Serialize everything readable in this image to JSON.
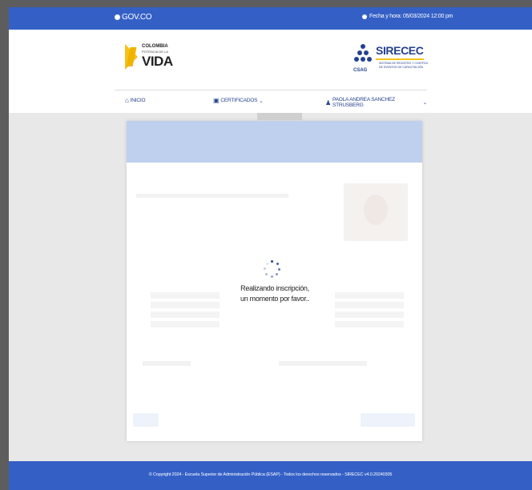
{
  "govbar": {
    "logo_text": "GOV.CO",
    "datetime": "Fecha y hora: 05/03/2024 12:00 pm"
  },
  "brand": {
    "colombia_line1": "COLOMBIA",
    "colombia_line2": "POTENCIA DE LA",
    "colombia_line3": "VIDA",
    "sirecec_name": "SIRECEC",
    "sirecec_sub": "SISTEMA DE REGISTRO Y CONTROL DE EVENTOS DE CAPACITACIÓN",
    "csag": "CSAG"
  },
  "nav": {
    "home": "INICIO",
    "certificates": "CERTIFICADOS",
    "user": "PAOLA ANDREA SANCHEZ STRUSBERG"
  },
  "loading": {
    "line1": "Realizando inscripción,",
    "line2": "un momento por favor.."
  },
  "footer": {
    "copyright": "© Copyright 2024 - Escuela Superior de Administración Pública (ESAP) - Todos los derechos reservados - SIRECEC v4.0.20240305"
  },
  "colors": {
    "brand_blue": "#3460c6",
    "dark_blue": "#24418f",
    "accent_yellow": "#f5c319"
  }
}
